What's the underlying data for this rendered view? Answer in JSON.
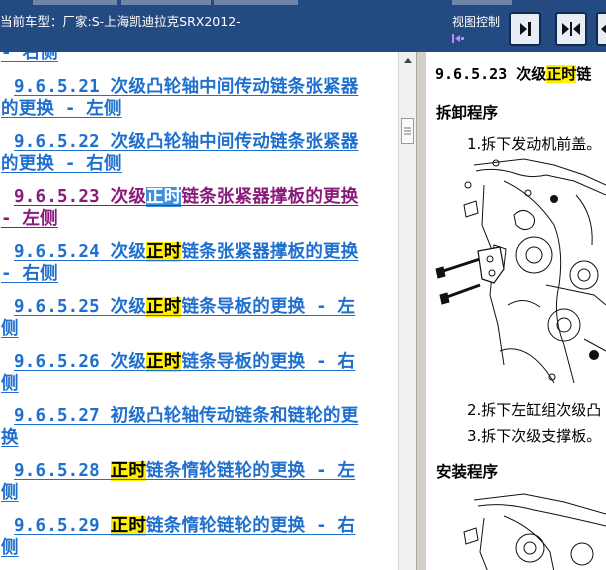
{
  "header": {
    "vehicle_label": "当前车型：厂家:S-上海凯迪拉克SRX2012-",
    "view_control_label": "视图控制"
  },
  "toc": {
    "partial_top_label": "- 右侧",
    "entries": [
      {
        "number": "9.6.5.21",
        "line1": "次级凸轮轴中间传动链条张紧器",
        "line2": "的更换 - 左侧"
      },
      {
        "number": "9.6.5.22",
        "line1": "次级凸轮轴中间传动链条张紧器",
        "line2": "的更换 - 右侧"
      },
      {
        "number": "9.6.5.23",
        "pre": "次级",
        "hl": "正时",
        "post": "链条张紧器撑板的更换",
        "line2": "- 左侧"
      },
      {
        "number": "9.6.5.24",
        "pre": "次级",
        "hl": "正时",
        "post": "链条张紧器撑板的更换",
        "line2": "- 右侧"
      },
      {
        "number": "9.6.5.25",
        "pre": "次级",
        "hl": "正时",
        "post": "链条导板的更换 - 左",
        "line2": "侧"
      },
      {
        "number": "9.6.5.26",
        "pre": "次级",
        "hl": "正时",
        "post": "链条导板的更换 - 右",
        "line2": "侧"
      },
      {
        "number": "9.6.5.27",
        "line1": "初级凸轮轴传动链条和链轮的更",
        "line2": "换"
      },
      {
        "number": "9.6.5.28",
        "pre": "",
        "hl": "正时",
        "post": "链条惰轮链轮的更换 - 左",
        "line2": "侧"
      },
      {
        "number": "9.6.5.29",
        "pre": "",
        "hl": "正时",
        "post": "链条惰轮链轮的更换 - 右",
        "line2": "侧"
      }
    ]
  },
  "document": {
    "title_number": "9.6.5.23",
    "title_pre": "次级",
    "title_hl": "正时",
    "title_post": "链",
    "removal_heading": "拆卸程序",
    "step1": "1.拆下发动机前盖。",
    "step2": "2.拆下左缸组次级凸",
    "step3": "3.拆下次级支撑板。",
    "install_heading": "安装程序"
  },
  "colors": {
    "header_bg": "#244a82",
    "link": "#1f6fcf",
    "visited": "#8a1a7a",
    "highlight": "#ffee00",
    "selection": "#3f8fe0"
  }
}
